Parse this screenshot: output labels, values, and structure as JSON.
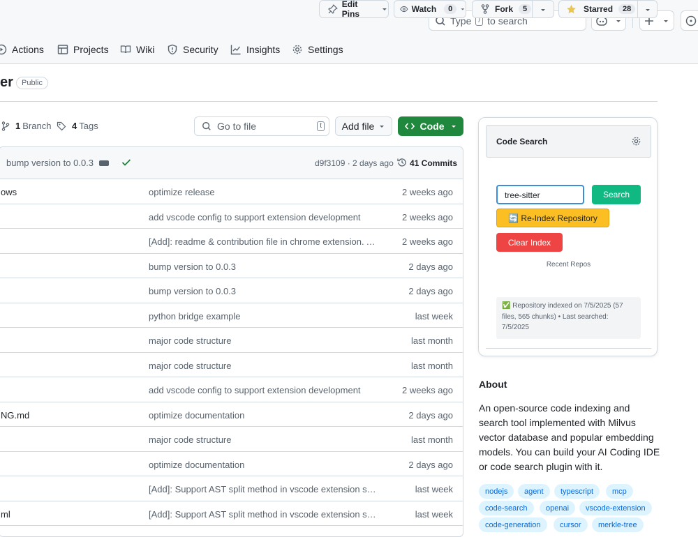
{
  "header": {
    "search_placeholder": "Type",
    "search_kbd": "/",
    "search_suffix": "to search"
  },
  "tabs": [
    {
      "label": "Actions"
    },
    {
      "label": "Projects"
    },
    {
      "label": "Wiki"
    },
    {
      "label": "Security"
    },
    {
      "label": "Insights"
    },
    {
      "label": "Settings"
    }
  ],
  "repo": {
    "name": "er",
    "visibility": "Public"
  },
  "actions": {
    "edit_pins": "Edit Pins",
    "watch": "Watch",
    "watch_count": "0",
    "fork": "Fork",
    "fork_count": "5",
    "starred": "Starred",
    "star_count": "28"
  },
  "branchbar": {
    "branch_count": "1",
    "branch_label": "Branch",
    "tag_count": "4",
    "tag_label": "Tags",
    "goto_placeholder": "Go to file",
    "goto_kbd": "t",
    "add_file": "Add file",
    "code": "Code"
  },
  "commit": {
    "message": "bump version to 0.0.3",
    "hash_time": "d9f3109 · 2 days ago",
    "commits": "41 Commits"
  },
  "files": [
    {
      "name": "ows",
      "message": "optimize release",
      "time": "2 weeks ago"
    },
    {
      "name": "",
      "message": "add vscode config to support extension development",
      "time": "2 weeks ago"
    },
    {
      "name": "",
      "message": "[Add]: readme & contribution file in chrome extension. An…",
      "time": "2 weeks ago"
    },
    {
      "name": "",
      "message": "bump version to 0.0.3",
      "time": "2 days ago"
    },
    {
      "name": "",
      "message": "bump version to 0.0.3",
      "time": "2 days ago"
    },
    {
      "name": "",
      "message": "python bridge example",
      "time": "last week"
    },
    {
      "name": "",
      "message": "major code structure",
      "time": "last month"
    },
    {
      "name": "",
      "message": "major code structure",
      "time": "last month"
    },
    {
      "name": "",
      "message": "add vscode config to support extension development",
      "time": "2 weeks ago"
    },
    {
      "name": "NG.md",
      "message": "optimize documentation",
      "time": "2 days ago"
    },
    {
      "name": "",
      "message": "major code structure",
      "time": "last month"
    },
    {
      "name": "",
      "message": "optimize documentation",
      "time": "2 days ago"
    },
    {
      "name": "",
      "message": "[Add]: Support AST split method in vscode extension san…",
      "time": "last week"
    },
    {
      "name": "ml",
      "message": "[Add]: Support AST split method in vscode extension san…",
      "time": "last week"
    }
  ],
  "code_search": {
    "title": "Code Search",
    "input_value": "tree-sitter",
    "search_button": "Search",
    "reindex_button": "🔄 Re-Index Repository",
    "clear_button": "Clear Index",
    "recent_label": "Recent Repos",
    "status": "✅ Repository indexed on 7/5/2025 (57 files, 565 chunks) • Last searched: 7/5/2025"
  },
  "about": {
    "title": "About",
    "description": "An open-source code indexing and search tool implemented with Milvus vector database and popular embedding models. You can build your AI Coding IDE or code search plugin with it.",
    "topics": [
      "nodejs",
      "agent",
      "typescript",
      "mcp",
      "code-search",
      "openai",
      "vscode-extension",
      "code-generation",
      "cursor",
      "merkle-tree"
    ]
  },
  "colors": {
    "primary_green": "#1f883d",
    "reindex_yellow": "#fbbf24",
    "clear_red": "#ef4444",
    "search_green": "#10b981",
    "link_blue": "#0969da"
  }
}
